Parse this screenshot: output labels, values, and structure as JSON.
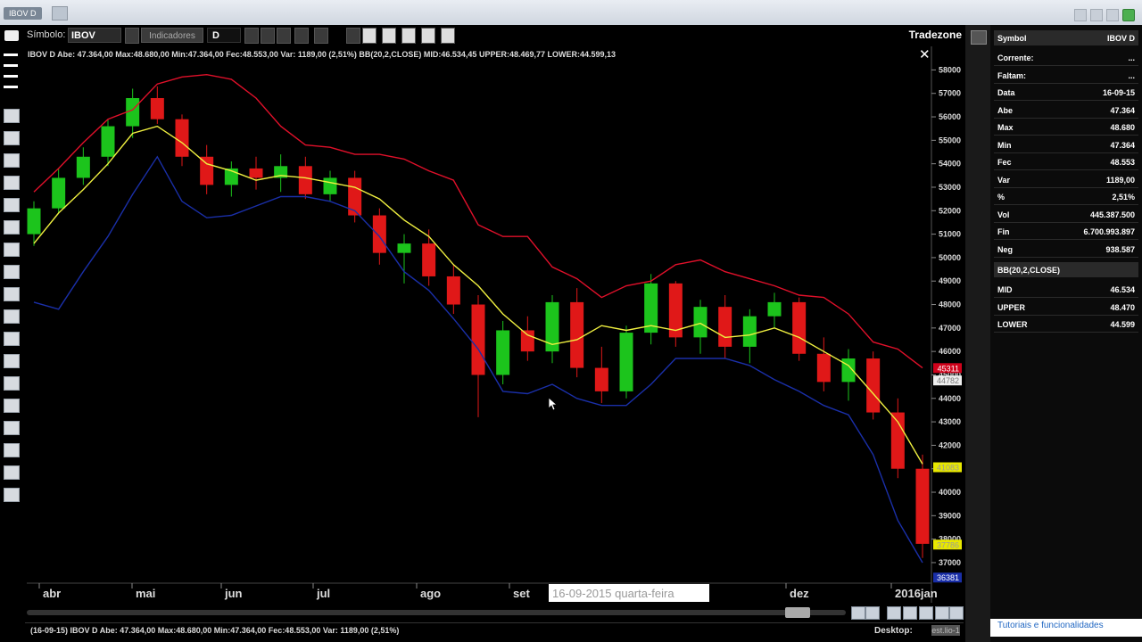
{
  "window": {
    "title_label": "IBOV D"
  },
  "toolbar": {
    "symbol_label": "Símbolo:",
    "symbol_value": "IBOV",
    "indicators_label": "Indicadores",
    "period_value": "D",
    "brand": "Tradezone"
  },
  "legend": {
    "text": "IBOV D  Abe: 47.364,00  Max:48.680,00  Min:47.364,00  Fec:48.553,00  Var: 1189,00 (2,51%)  BB(20,2,CLOSE) MID:46.534,45  UPPER:48.469,77  LOWER:44.599,13"
  },
  "chart_data": {
    "type": "candlestick",
    "title": "",
    "xlabel": "",
    "ylabel": "",
    "x_ticks": [
      "abr",
      "mai",
      "jun",
      "jul",
      "ago",
      "set",
      "dez",
      "2016jan"
    ],
    "y_ticks": [
      37000,
      38000,
      39000,
      40000,
      41000,
      42000,
      43000,
      44000,
      45000,
      46000,
      47000,
      48000,
      49000,
      50000,
      51000,
      52000,
      53000,
      54000,
      55000,
      56000,
      57000,
      58000
    ],
    "ylim": [
      36200,
      58700
    ],
    "price_labels": {
      "top_red": "45311",
      "white_box": "44782",
      "yellow_box": "41083",
      "bottom_yellow": "37786",
      "bottom_blue": "36381"
    },
    "crosshair_label": "16-09-2015 quarta-feira",
    "series": [
      {
        "name": "BB UPPER",
        "color": "#e0102a",
        "values": [
          52800,
          53800,
          54900,
          55900,
          56300,
          57400,
          57700,
          57800,
          57600,
          56800,
          55600,
          54800,
          54700,
          54400,
          54400,
          54200,
          53700,
          53300,
          51400,
          50900,
          50900,
          49600,
          49100,
          48300,
          48800,
          49000,
          49700,
          49900,
          49400,
          49100,
          48800,
          48400,
          48300,
          47600,
          46400,
          46100,
          45300
        ]
      },
      {
        "name": "BB MID",
        "color": "#f0f040",
        "values": [
          50600,
          51900,
          52900,
          54000,
          55300,
          55600,
          54900,
          54000,
          53700,
          53300,
          53500,
          53400,
          53200,
          53000,
          52500,
          51600,
          50900,
          49700,
          48800,
          47600,
          46700,
          46300,
          46500,
          47100,
          46900,
          47100,
          46900,
          47200,
          46600,
          46700,
          47000,
          46600,
          46000,
          45400,
          44200,
          43000,
          41200
        ]
      },
      {
        "name": "BB LOWER",
        "color": "#1a2fa8",
        "values": [
          48100,
          47800,
          49400,
          50900,
          52700,
          54300,
          52400,
          51700,
          51800,
          52200,
          52600,
          52600,
          52400,
          52000,
          50900,
          49400,
          48600,
          47400,
          46100,
          44300,
          44200,
          44600,
          44000,
          43700,
          43700,
          44600,
          45700,
          45700,
          45700,
          45400,
          44800,
          44300,
          43700,
          43300,
          41600,
          38800,
          37000
        ]
      }
    ],
    "candles_summary": "daily candles, green up / red down, from ~51000 (abr) peaking ~57000 (mai) declining to ~37800 (2016jan)",
    "candles": [
      [
        51000,
        52400,
        50500,
        52100
      ],
      [
        52100,
        53800,
        51900,
        53400
      ],
      [
        53400,
        54700,
        53100,
        54300
      ],
      [
        54300,
        55900,
        53900,
        55600
      ],
      [
        55600,
        57200,
        55100,
        56800
      ],
      [
        56800,
        57300,
        55700,
        55900
      ],
      [
        55900,
        56100,
        53900,
        54300
      ],
      [
        54300,
        54800,
        52700,
        53100
      ],
      [
        53100,
        54100,
        52600,
        53800
      ],
      [
        53800,
        54300,
        52900,
        53400
      ],
      [
        53400,
        54400,
        52800,
        53900
      ],
      [
        53900,
        54300,
        52500,
        52700
      ],
      [
        52700,
        53700,
        52400,
        53400
      ],
      [
        53400,
        53700,
        51500,
        51800
      ],
      [
        51800,
        52100,
        49700,
        50200
      ],
      [
        50200,
        51000,
        48900,
        50600
      ],
      [
        50600,
        51200,
        48800,
        49200
      ],
      [
        49200,
        49700,
        47600,
        48000
      ],
      [
        48000,
        48400,
        43200,
        45000
      ],
      [
        45000,
        47300,
        44600,
        46900
      ],
      [
        46900,
        47500,
        45600,
        46000
      ],
      [
        46000,
        48400,
        45500,
        48100
      ],
      [
        48100,
        48700,
        44900,
        45300
      ],
      [
        45300,
        46200,
        43800,
        44300
      ],
      [
        44300,
        47100,
        44000,
        46800
      ],
      [
        46800,
        49300,
        46300,
        48900
      ],
      [
        48900,
        49000,
        46200,
        46600
      ],
      [
        46600,
        48200,
        45900,
        47900
      ],
      [
        47900,
        48400,
        45700,
        46200
      ],
      [
        46200,
        47800,
        45500,
        47500
      ],
      [
        47500,
        48500,
        47000,
        48100
      ],
      [
        48100,
        48300,
        45600,
        45900
      ],
      [
        45900,
        46600,
        44300,
        44700
      ],
      [
        44700,
        46100,
        43900,
        45700
      ],
      [
        45700,
        46000,
        43100,
        43400
      ],
      [
        43400,
        44000,
        40600,
        41000
      ],
      [
        41000,
        41600,
        37200,
        37800
      ]
    ]
  },
  "status": {
    "text": "(16-09-15)  IBOV D  Abe: 47.364,00  Max:48.680,00  Min:47.364,00  Fec:48.553,00  Var: 1189,00 (2,51%)",
    "desktop_label": "Desktop:",
    "desktop_value": "est.lio-1"
  },
  "panel": {
    "header_key": "Symbol",
    "header_val": "IBOV D",
    "rows": [
      {
        "k": "Corrente:",
        "v": "..."
      },
      {
        "k": "Faltam:",
        "v": "..."
      },
      {
        "k": "Data",
        "v": "16-09-15"
      },
      {
        "k": "Abe",
        "v": "47.364"
      },
      {
        "k": "Max",
        "v": "48.680"
      },
      {
        "k": "Min",
        "v": "47.364"
      },
      {
        "k": "Fec",
        "v": "48.553"
      },
      {
        "k": "Var",
        "v": "1189,00"
      },
      {
        "k": "%",
        "v": "2,51%"
      },
      {
        "k": "Vol",
        "v": "445.387.500"
      },
      {
        "k": "Fin",
        "v": "6.700.993.897"
      },
      {
        "k": "Neg",
        "v": "938.587"
      }
    ],
    "bb_title": "BB(20,2,CLOSE)",
    "bb_rows": [
      {
        "k": "MID",
        "v": "46.534"
      },
      {
        "k": "UPPER",
        "v": "48.470"
      },
      {
        "k": "LOWER",
        "v": "44.599"
      }
    ],
    "tutorial_link": "Tutoriais e funcionalidades"
  }
}
